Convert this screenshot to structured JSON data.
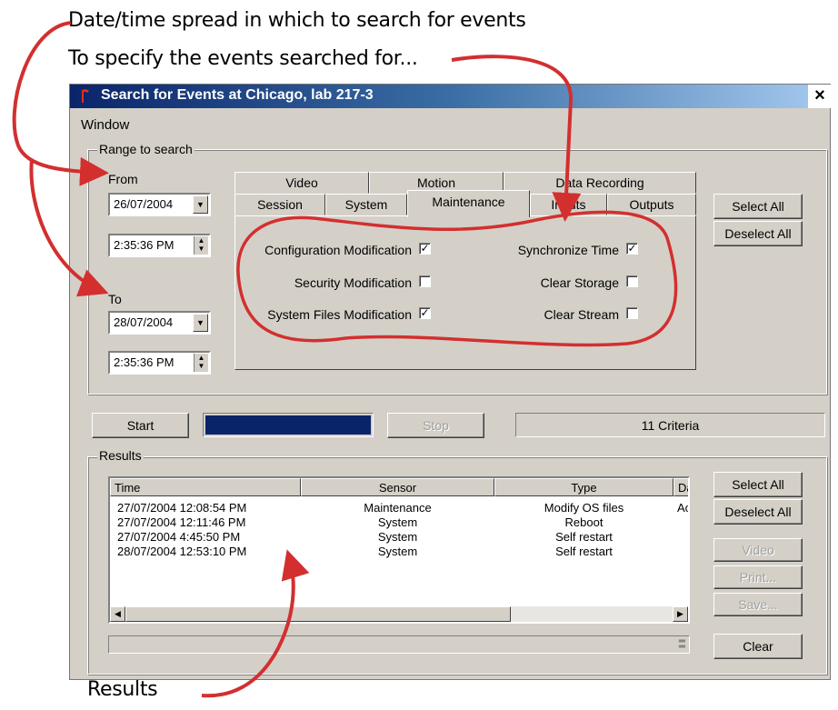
{
  "callouts": {
    "date_range": "Date/time spread in which to search for events",
    "events": "To specify the events searched for...",
    "results": "Results"
  },
  "window": {
    "title": "Search for Events at Chicago, lab 217-3",
    "close": "×",
    "menu": [
      "Window"
    ]
  },
  "range": {
    "group_label": "Range to search",
    "from_label": "From",
    "from_date": "26/07/2004",
    "from_time": "2:35:36 PM",
    "to_label": "To",
    "to_date": "28/07/2004",
    "to_time": "2:35:36 PM"
  },
  "tabs": {
    "row1": [
      "Video",
      "Motion",
      "Data Recording"
    ],
    "row2": [
      "Session",
      "System",
      "Maintenance",
      "Inputs",
      "Outputs"
    ],
    "active": "Maintenance"
  },
  "maintenance": {
    "items": [
      {
        "label": "Configuration Modification",
        "checked": true
      },
      {
        "label": "Security Modification",
        "checked": false
      },
      {
        "label": "System Files Modification",
        "checked": true
      },
      {
        "label": "Synchronize Time",
        "checked": true
      },
      {
        "label": "Clear Storage",
        "checked": false
      },
      {
        "label": "Clear Stream",
        "checked": false
      }
    ]
  },
  "buttons": {
    "select_all": "Select All",
    "deselect_all": "Deselect All",
    "start": "Start",
    "stop": "Stop",
    "criteria": "11 Criteria",
    "results_select_all": "Select All",
    "results_deselect_all": "Deselect All",
    "video": "Video",
    "print": "Print...",
    "save": "Save...",
    "clear": "Clear"
  },
  "progress": 1.0,
  "results": {
    "group_label": "Results",
    "columns": [
      "Time",
      "Sensor",
      "Type",
      "Da"
    ],
    "rows": [
      [
        "27/07/2004 12:08:54 PM",
        "Maintenance",
        "Modify OS files",
        "Ac"
      ],
      [
        "27/07/2004 12:11:46 PM",
        "System",
        "Reboot",
        ""
      ],
      [
        "27/07/2004 4:45:50 PM",
        "System",
        "Self restart",
        ""
      ],
      [
        "28/07/2004 12:53:10 PM",
        "System",
        "Self restart",
        ""
      ]
    ]
  },
  "colors": {
    "title_bar": "#0a246a",
    "progress_fill": "#0a246a",
    "annotation": "#d32f2f",
    "face": "#d4d0c8"
  }
}
